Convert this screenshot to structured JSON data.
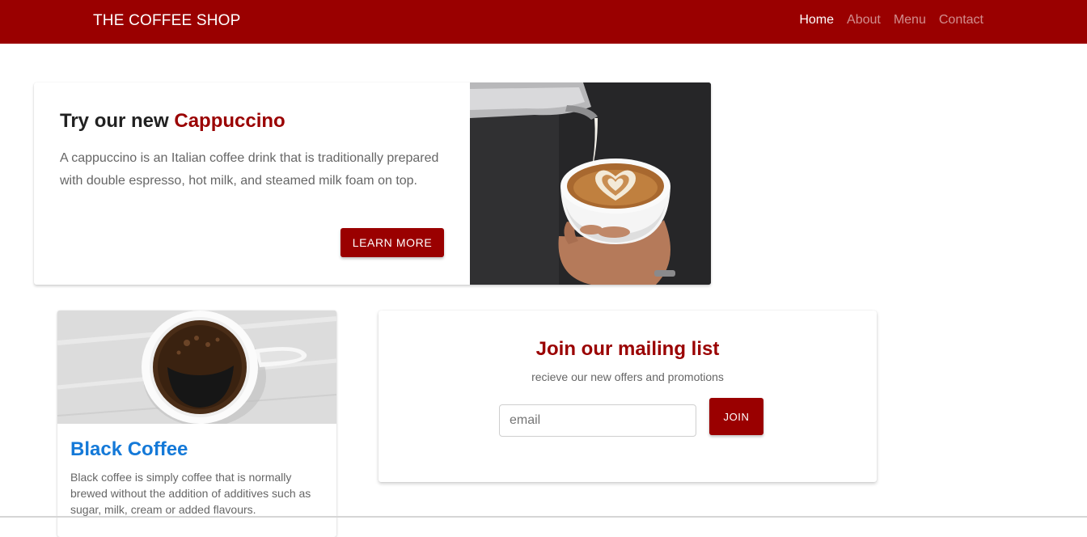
{
  "navbar": {
    "brand": "THE COFFEE SHOP",
    "links": [
      {
        "label": "Home",
        "active": true
      },
      {
        "label": "About",
        "active": false
      },
      {
        "label": "Menu",
        "active": false
      },
      {
        "label": "Contact",
        "active": false
      }
    ]
  },
  "hero": {
    "title_prefix": "Try our new ",
    "title_accent": "Cappuccino",
    "description": "A cappuccino is an Italian coffee drink that is traditionally prepared with double espresso, hot milk, and steamed milk foam on top.",
    "button_label": "LEARN MORE",
    "image_icon": "latte-art-pour-photo"
  },
  "product_card": {
    "title": "Black Coffee",
    "description": "Black coffee is simply coffee that is normally brewed without the addition of additives such as sugar, milk, cream or added flavours.",
    "image_icon": "black-coffee-cup-photo"
  },
  "mailing": {
    "title": "Join our mailing list",
    "subtitle": "recieve our new offers and promotions",
    "email_placeholder": "email",
    "email_value": "",
    "button_label": "JOIN"
  },
  "colors": {
    "brand": "#9a0000",
    "link_blue": "#1479d8",
    "muted_text": "#666666"
  }
}
